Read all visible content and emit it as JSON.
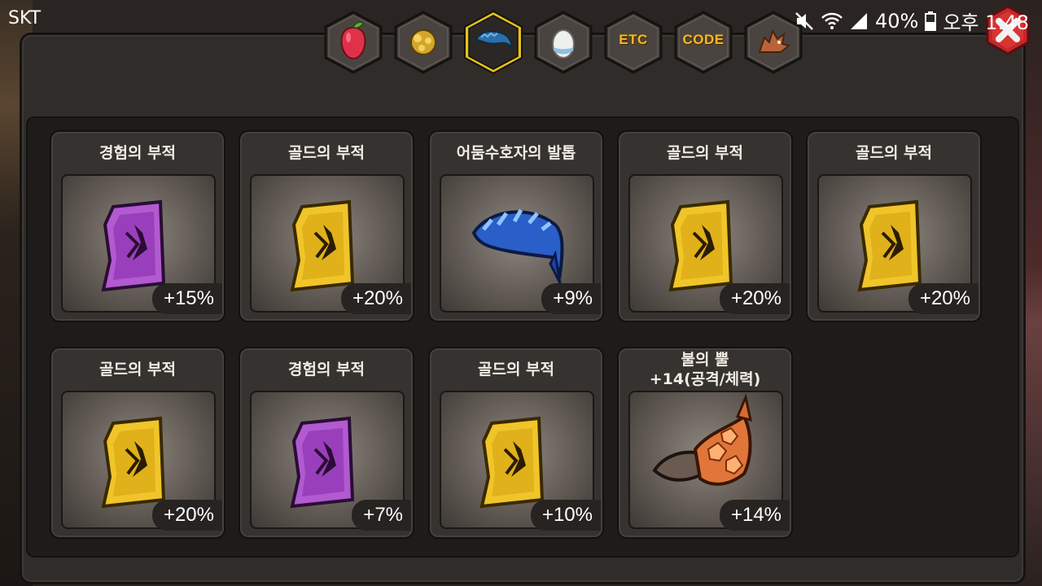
{
  "status_bar": {
    "carrier": "SKT",
    "battery": "40%",
    "time": "오후 1:48",
    "icons": [
      "mute-icon",
      "wifi-icon",
      "signal-icon",
      "battery-icon"
    ]
  },
  "tabs": [
    {
      "name": "fruit",
      "icon": "fruit-icon",
      "label": "",
      "selected": false
    },
    {
      "name": "gem",
      "icon": "gem-icon",
      "label": "",
      "selected": false
    },
    {
      "name": "talisman",
      "icon": "claw-icon",
      "label": "",
      "selected": true
    },
    {
      "name": "egg",
      "icon": "egg-icon",
      "label": "",
      "selected": false
    },
    {
      "name": "etc",
      "icon": "",
      "label": "ETC",
      "selected": false
    },
    {
      "name": "code",
      "icon": "",
      "label": "CODE",
      "selected": false
    },
    {
      "name": "dragon",
      "icon": "dragon-icon",
      "label": "",
      "selected": false
    }
  ],
  "items": [
    {
      "name": "경험의 부적",
      "bonus": "+15%",
      "icon": "purple-talisman-icon"
    },
    {
      "name": "골드의 부적",
      "bonus": "+20%",
      "icon": "gold-talisman-icon"
    },
    {
      "name": "어둠수호자의 발톱",
      "bonus": "+9%",
      "icon": "blue-claw-icon"
    },
    {
      "name": "골드의 부적",
      "bonus": "+20%",
      "icon": "gold-talisman-icon"
    },
    {
      "name": "골드의 부적",
      "bonus": "+20%",
      "icon": "gold-talisman-icon"
    },
    {
      "name": "골드의 부적",
      "bonus": "+20%",
      "icon": "gold-talisman-icon"
    },
    {
      "name": "경험의 부적",
      "bonus": "+7%",
      "icon": "purple-talisman-icon"
    },
    {
      "name": "골드의 부적",
      "bonus": "+10%",
      "icon": "gold-talisman-icon"
    },
    {
      "name": "불의 뿔\n+14(공격/체력)",
      "bonus": "+14%",
      "icon": "fire-horn-icon"
    }
  ],
  "colors": {
    "tab_selected_border": "#e8c11a",
    "tab_text": "#f5b829",
    "close_button": "#c4262a"
  }
}
